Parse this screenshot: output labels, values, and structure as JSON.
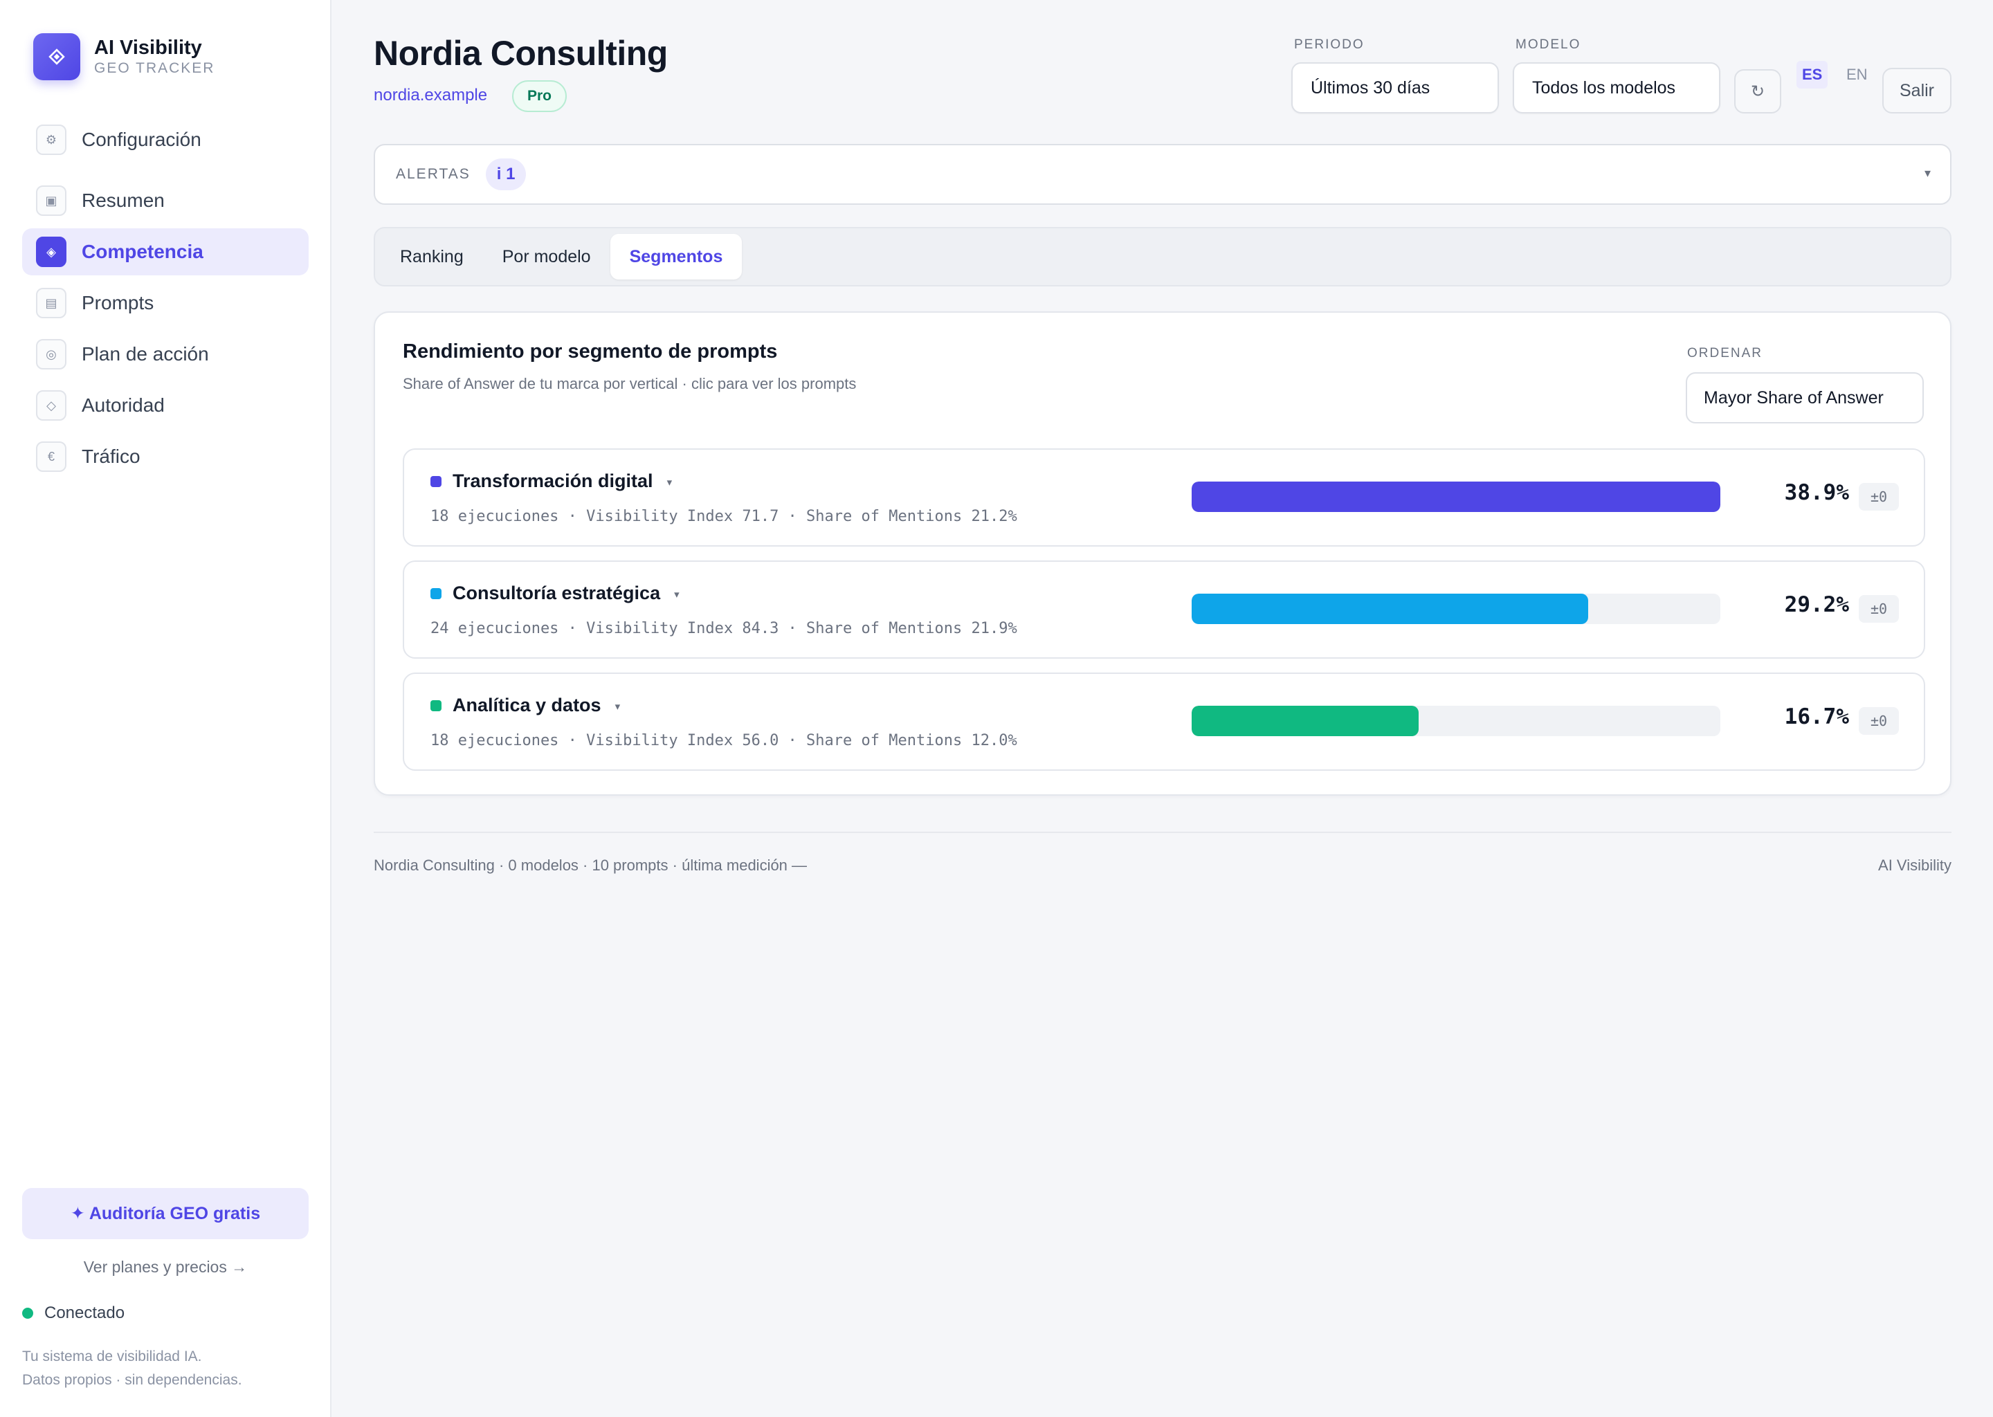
{
  "brand": {
    "title": "AI Visibility",
    "subtitle": "GEO TRACKER",
    "logo_icon": "diamond-icon"
  },
  "sidebar": {
    "items": [
      {
        "label": "Configuración",
        "icon": "gear-icon",
        "glyph": "⚙",
        "active": false
      },
      {
        "label": "Resumen",
        "icon": "summary-icon",
        "glyph": "▣",
        "active": false
      },
      {
        "label": "Competencia",
        "icon": "diamond-icon",
        "glyph": "◈",
        "active": true
      },
      {
        "label": "Prompts",
        "icon": "list-icon",
        "glyph": "▤",
        "active": false
      },
      {
        "label": "Plan de acción",
        "icon": "target-icon",
        "glyph": "◎",
        "active": false
      },
      {
        "label": "Autoridad",
        "icon": "diamond-outline-icon",
        "glyph": "◇",
        "active": false
      },
      {
        "label": "Tráfico",
        "icon": "euro-icon",
        "glyph": "€",
        "active": false
      }
    ],
    "audit_button": "✦ Auditoría GEO gratis",
    "plans_link": "Ver planes y precios →",
    "status": "Conectado",
    "status_color": "#10b981",
    "tagline_1": "Tu sistema de visibilidad IA.",
    "tagline_2": "Datos propios · sin dependencias."
  },
  "header": {
    "title": "Nordia Consulting",
    "domain": "nordia.example",
    "plan_badge": "Pro",
    "period_label": "PERIODO",
    "period_value": "Últimos 30 días",
    "model_label": "MODELO",
    "model_value": "Todos los modelos",
    "refresh_icon": "refresh-icon",
    "refresh_glyph": "↻",
    "lang_es": "ES",
    "lang_en": "EN",
    "active_lang": "ES",
    "exit_label": "Salir"
  },
  "alerts": {
    "label": "ALERTAS",
    "badge": "i 1",
    "chevron": "▾"
  },
  "tabs": [
    {
      "label": "Ranking",
      "active": false
    },
    {
      "label": "Por modelo",
      "active": false
    },
    {
      "label": "Segmentos",
      "active": true
    }
  ],
  "segments_card": {
    "title": "Rendimiento por segmento de prompts",
    "subtitle": "Share of Answer de tu marca por vertical · clic para ver los prompts",
    "sort_label": "ORDENAR",
    "sort_value": "Mayor Share of Answer",
    "caret": "▾",
    "bar_scale_max": 38.9,
    "segments": [
      {
        "name": "Transformación digital",
        "meta": "18 ejecuciones · Visibility Index 71.7 · Share of Mentions 21.2%",
        "value": 38.9,
        "value_label": "38.9%",
        "delta": "±0",
        "color": "#4f46e5"
      },
      {
        "name": "Consultoría estratégica",
        "meta": "24 ejecuciones · Visibility Index 84.3 · Share of Mentions 21.9%",
        "value": 29.2,
        "value_label": "29.2%",
        "delta": "±0",
        "color": "#0ea5e9"
      },
      {
        "name": "Analítica y datos",
        "meta": "18 ejecuciones · Visibility Index 56.0 · Share of Mentions 12.0%",
        "value": 16.7,
        "value_label": "16.7%",
        "delta": "±0",
        "color": "#10b981"
      }
    ]
  },
  "footer": {
    "left": "Nordia Consulting · 0 modelos · 10 prompts · última medición —",
    "right": "AI Visibility"
  },
  "colors": {
    "accent": "#4f46e5",
    "accent_soft": "#ecebfd",
    "success": "#10b981"
  }
}
